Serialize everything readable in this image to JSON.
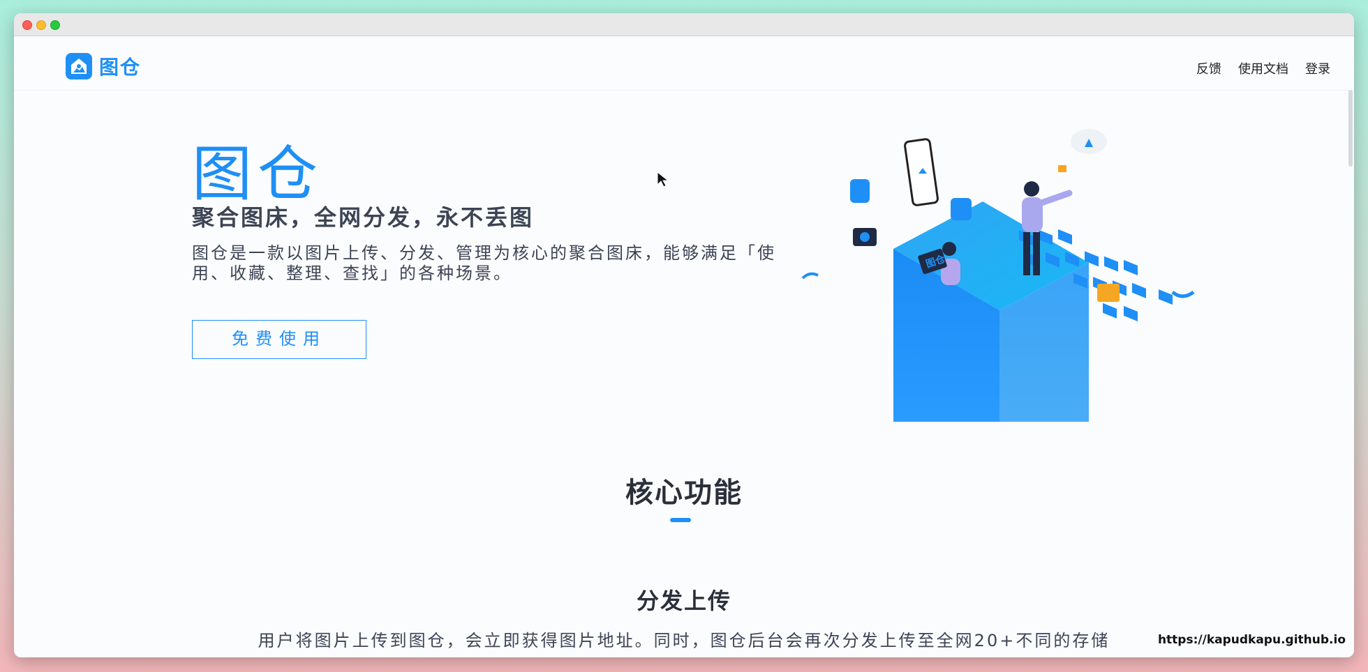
{
  "nav": {
    "logo_text": "图仓",
    "links": [
      "反馈",
      "使用文档",
      "登录"
    ]
  },
  "hero": {
    "title": "图仓",
    "subtitle": "聚合图床，全网分发，永不丢图",
    "description": "图仓是一款以图片上传、分发、管理为核心的聚合图床，能够满足「使用、收藏、整理、查找」的各种场景。",
    "cta_label": "免费使用",
    "illustration_text": "图仓"
  },
  "features": {
    "section_title": "核心功能",
    "items": [
      {
        "title": "分发上传",
        "description": "用户将图片上传到图仓，会立即获得图片地址。同时，图仓后台会再次分发上传至全网20+不同的存储"
      }
    ]
  },
  "watermark": "https://kapudkapu.github.io",
  "colors": {
    "accent": "#1e8ff6",
    "text_dark": "#3c4454",
    "background": "#fbfcfe"
  },
  "icons": {
    "logo": "home-photo-icon",
    "cursor": "arrow-cursor-icon"
  }
}
